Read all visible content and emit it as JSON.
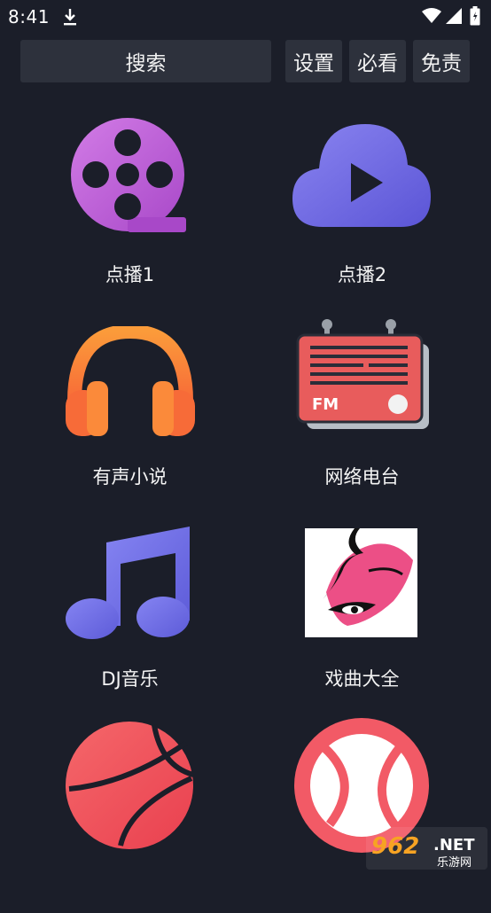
{
  "status_bar": {
    "time": "8:41",
    "icons": [
      "download-icon",
      "wifi-icon",
      "signal-icon",
      "battery-icon"
    ]
  },
  "toolbar": {
    "search_label": "搜索",
    "settings_label": "设置",
    "mustsee_label": "必看",
    "disclaimer_label": "免责"
  },
  "tiles": [
    {
      "label": "点播1",
      "icon": "film-reel-icon",
      "color": "#c36ad9"
    },
    {
      "label": "点播2",
      "icon": "cloud-play-icon",
      "color": "#7069e6"
    },
    {
      "label": "有声小说",
      "icon": "headphones-icon",
      "color": "#fb7a3a"
    },
    {
      "label": "网络电台",
      "icon": "fm-radio-icon",
      "color": "#e85c5c"
    },
    {
      "label": "DJ音乐",
      "icon": "music-note-icon",
      "color": "#6f6ee6"
    },
    {
      "label": "戏曲大全",
      "icon": "opera-mask-icon",
      "color": "#e8437a"
    },
    {
      "label": "",
      "icon": "basketball-icon",
      "color": "#f0515e"
    },
    {
      "label": "",
      "icon": "tennis-ball-icon",
      "color": "#f25a66"
    }
  ],
  "watermark": {
    "number": "962",
    "suffix": ".NET",
    "subtitle": "乐游网"
  }
}
